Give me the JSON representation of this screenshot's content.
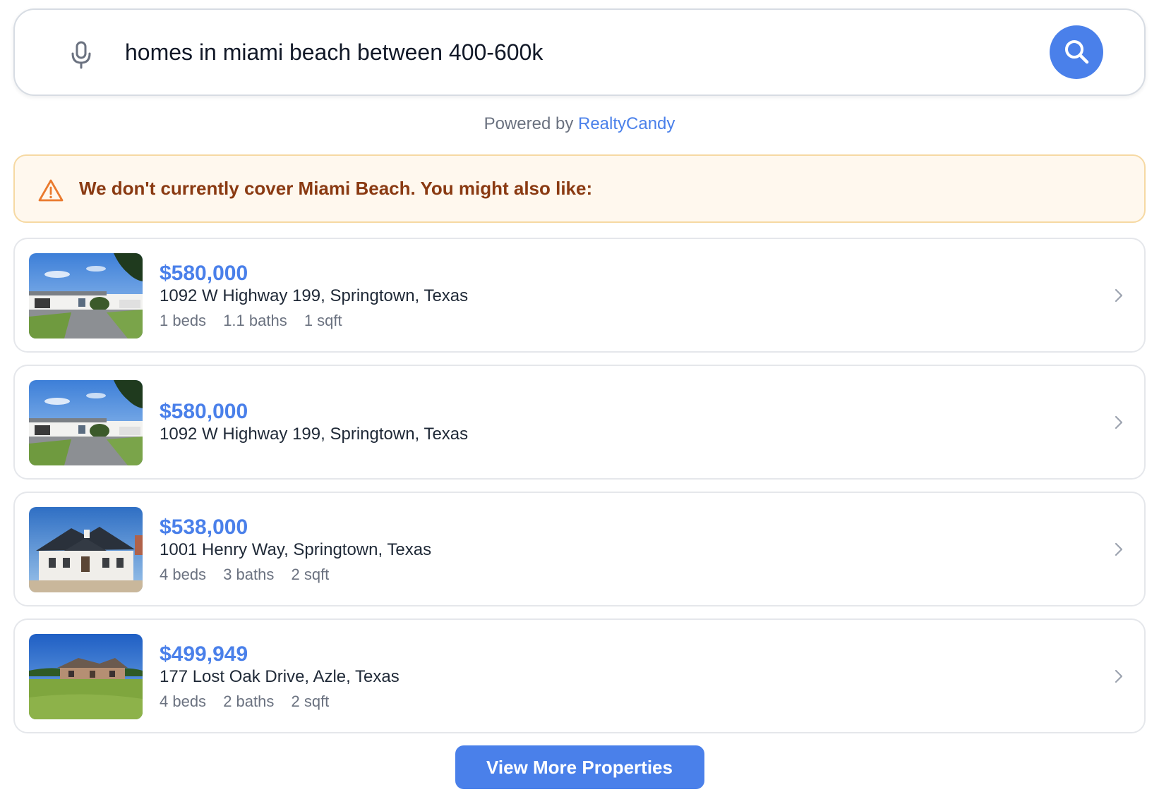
{
  "search": {
    "query": "homes in miami beach between 400-600k",
    "mic_icon": "microphone-icon",
    "search_icon": "magnifier-icon"
  },
  "powered_by": {
    "prefix": "Powered by",
    "brand": "RealtyCandy"
  },
  "notice": {
    "icon": "warning-triangle-icon",
    "text": "We don't currently cover Miami Beach. You might also like:"
  },
  "listings": [
    {
      "price": "$580,000",
      "address": "1092 W Highway 199, Springtown, Texas",
      "beds": "1 beds",
      "baths": "1.1 baths",
      "sqft": "1 sqft",
      "thumb": "commercial-building-photo"
    },
    {
      "price": "$580,000",
      "address": "1092 W Highway 199, Springtown, Texas",
      "beds": "",
      "baths": "",
      "sqft": "",
      "thumb": "commercial-building-photo"
    },
    {
      "price": "$538,000",
      "address": "1001 Henry Way, Springtown, Texas",
      "beds": "4 beds",
      "baths": "3 baths",
      "sqft": "2 sqft",
      "thumb": "white-house-photo"
    },
    {
      "price": "$499,949",
      "address": "177 Lost Oak Drive, Azle, Texas",
      "beds": "4 beds",
      "baths": "2 baths",
      "sqft": "2 sqft",
      "thumb": "ranch-house-photo"
    }
  ],
  "view_more_label": "View More Properties",
  "colors": {
    "accent": "#4a80ea",
    "warning_bg": "#fff8ee",
    "warning_border": "#f6d9a3",
    "warning_text": "#8a3a12"
  }
}
